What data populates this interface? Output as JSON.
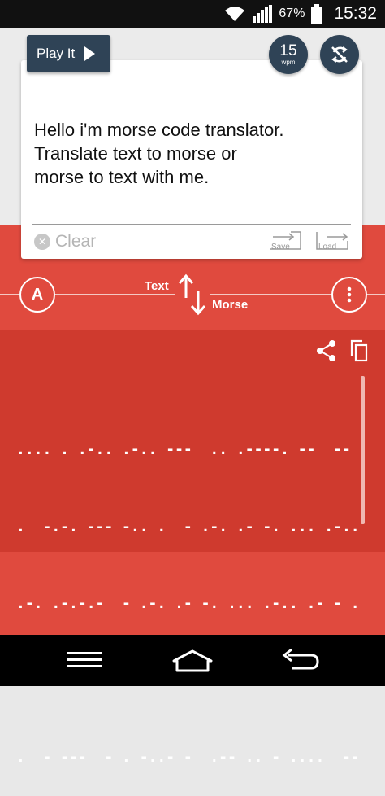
{
  "status_bar": {
    "battery": "67%",
    "time": "15:32"
  },
  "toolbar": {
    "play_label": "Play It",
    "wpm_value": "15",
    "wpm_unit": "wpm"
  },
  "input": {
    "text": "Hello i'm morse code translator.\nTranslate text to morse or\nmorse to text with me.",
    "clear_label": "Clear",
    "save_label": "Save",
    "load_label": "Load"
  },
  "direction": {
    "from_label": "Text",
    "to_label": "Morse",
    "alphabet_button": "A"
  },
  "output": {
    "morse_lines": [
      ".... . .-.. .-.. ---  .. .----. --  -- --- .-. ...",
      ".  -.-. --- -.. .  - .-. .- -. ... .-.. .- - ---",
      ".-. .-.-.-  - .-. .- -. ... .-.. .- - .  - --- .-.-",
      "- ---  -- --- .-. ... .  --- .-.  -- --- .-. ...",
      ".  - ---  - . -..- -  .-- .. - ....  -- . .-.-.-"
    ]
  },
  "icons": {
    "share": "share-icon",
    "copy": "copy-icon",
    "sync": "sync-off-icon",
    "more": "more-vert-icon",
    "swap": "swap-arrows-icon"
  },
  "colors": {
    "accent_red": "#e04a3e",
    "dark_red": "#cf3a2e",
    "navy": "#2f4356"
  }
}
